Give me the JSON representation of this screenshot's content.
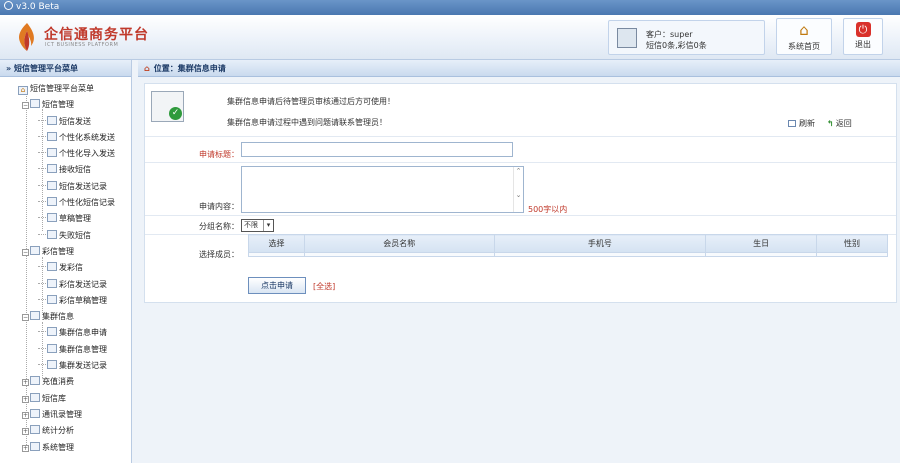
{
  "window": {
    "title": "v3.0  Beta"
  },
  "header": {
    "logo_title": "企信通商务平台",
    "logo_subtitle": "ICT BUSINESS PLATFORM",
    "customer_line": "客户：super",
    "balance_line": "短信0条,彩信0条",
    "home_button": "系统首页",
    "logout_button": "退出"
  },
  "sidebar": {
    "title": "» 短信管理平台菜单",
    "root": "短信管理平台菜单",
    "groups": [
      {
        "label": "短信管理",
        "expanded": true,
        "items": [
          "短信发送",
          "个性化系统发送",
          "个性化导入发送",
          "接收短信",
          "短信发送记录",
          "个性化短信记录",
          "草稿管理",
          "失败短信"
        ]
      },
      {
        "label": "彩信管理",
        "expanded": true,
        "items": [
          "发彩信",
          "彩信发送记录",
          "彩信草稿管理"
        ]
      },
      {
        "label": "集群信息",
        "expanded": true,
        "items": [
          "集群信息申请",
          "集群信息管理",
          "集群发送记录"
        ]
      },
      {
        "label": "充值消费",
        "expanded": false,
        "items": []
      },
      {
        "label": "短信库",
        "expanded": false,
        "items": []
      },
      {
        "label": "通讯录管理",
        "expanded": false,
        "items": []
      },
      {
        "label": "统计分析",
        "expanded": false,
        "items": []
      },
      {
        "label": "系统管理",
        "expanded": false,
        "items": []
      }
    ]
  },
  "content": {
    "breadcrumb": "位置：集群信息申请",
    "notice_1": "集群信息申请后待管理员审核通过后方可使用！",
    "notice_2": "集群信息申请过程中遇到问题请联系管理员！",
    "refresh": "刷新",
    "back": "返回",
    "form": {
      "title_label": "申请标题：",
      "title_value": "",
      "content_label": "申请内容：",
      "content_value": "",
      "content_hint": "500字以内",
      "group_label": "分组名称：",
      "group_value": "不限",
      "members_label": "选择成员：",
      "member_columns": [
        "选择",
        "会员名称",
        "手机号",
        "生日",
        "性别"
      ],
      "submit": "点击申请",
      "select_all": "[全选]"
    }
  }
}
